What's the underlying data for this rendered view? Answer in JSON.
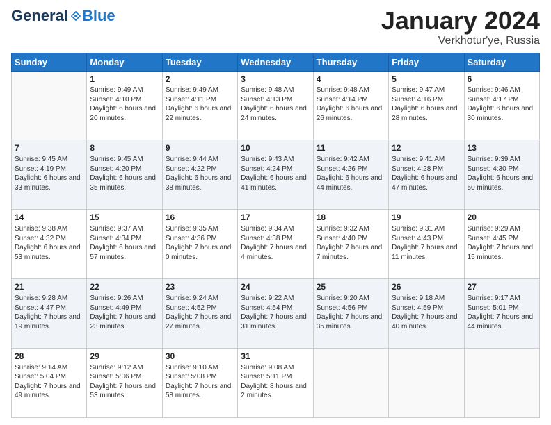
{
  "header": {
    "logo_general": "General",
    "logo_blue": "Blue",
    "month_title": "January 2024",
    "location": "Verkhotur'ye, Russia"
  },
  "days_of_week": [
    "Sunday",
    "Monday",
    "Tuesday",
    "Wednesday",
    "Thursday",
    "Friday",
    "Saturday"
  ],
  "weeks": [
    [
      {
        "day": "",
        "sunrise": "",
        "sunset": "",
        "daylight": ""
      },
      {
        "day": "1",
        "sunrise": "Sunrise: 9:49 AM",
        "sunset": "Sunset: 4:10 PM",
        "daylight": "Daylight: 6 hours and 20 minutes."
      },
      {
        "day": "2",
        "sunrise": "Sunrise: 9:49 AM",
        "sunset": "Sunset: 4:11 PM",
        "daylight": "Daylight: 6 hours and 22 minutes."
      },
      {
        "day": "3",
        "sunrise": "Sunrise: 9:48 AM",
        "sunset": "Sunset: 4:13 PM",
        "daylight": "Daylight: 6 hours and 24 minutes."
      },
      {
        "day": "4",
        "sunrise": "Sunrise: 9:48 AM",
        "sunset": "Sunset: 4:14 PM",
        "daylight": "Daylight: 6 hours and 26 minutes."
      },
      {
        "day": "5",
        "sunrise": "Sunrise: 9:47 AM",
        "sunset": "Sunset: 4:16 PM",
        "daylight": "Daylight: 6 hours and 28 minutes."
      },
      {
        "day": "6",
        "sunrise": "Sunrise: 9:46 AM",
        "sunset": "Sunset: 4:17 PM",
        "daylight": "Daylight: 6 hours and 30 minutes."
      }
    ],
    [
      {
        "day": "7",
        "sunrise": "Sunrise: 9:45 AM",
        "sunset": "Sunset: 4:19 PM",
        "daylight": "Daylight: 6 hours and 33 minutes."
      },
      {
        "day": "8",
        "sunrise": "Sunrise: 9:45 AM",
        "sunset": "Sunset: 4:20 PM",
        "daylight": "Daylight: 6 hours and 35 minutes."
      },
      {
        "day": "9",
        "sunrise": "Sunrise: 9:44 AM",
        "sunset": "Sunset: 4:22 PM",
        "daylight": "Daylight: 6 hours and 38 minutes."
      },
      {
        "day": "10",
        "sunrise": "Sunrise: 9:43 AM",
        "sunset": "Sunset: 4:24 PM",
        "daylight": "Daylight: 6 hours and 41 minutes."
      },
      {
        "day": "11",
        "sunrise": "Sunrise: 9:42 AM",
        "sunset": "Sunset: 4:26 PM",
        "daylight": "Daylight: 6 hours and 44 minutes."
      },
      {
        "day": "12",
        "sunrise": "Sunrise: 9:41 AM",
        "sunset": "Sunset: 4:28 PM",
        "daylight": "Daylight: 6 hours and 47 minutes."
      },
      {
        "day": "13",
        "sunrise": "Sunrise: 9:39 AM",
        "sunset": "Sunset: 4:30 PM",
        "daylight": "Daylight: 6 hours and 50 minutes."
      }
    ],
    [
      {
        "day": "14",
        "sunrise": "Sunrise: 9:38 AM",
        "sunset": "Sunset: 4:32 PM",
        "daylight": "Daylight: 6 hours and 53 minutes."
      },
      {
        "day": "15",
        "sunrise": "Sunrise: 9:37 AM",
        "sunset": "Sunset: 4:34 PM",
        "daylight": "Daylight: 6 hours and 57 minutes."
      },
      {
        "day": "16",
        "sunrise": "Sunrise: 9:35 AM",
        "sunset": "Sunset: 4:36 PM",
        "daylight": "Daylight: 7 hours and 0 minutes."
      },
      {
        "day": "17",
        "sunrise": "Sunrise: 9:34 AM",
        "sunset": "Sunset: 4:38 PM",
        "daylight": "Daylight: 7 hours and 4 minutes."
      },
      {
        "day": "18",
        "sunrise": "Sunrise: 9:32 AM",
        "sunset": "Sunset: 4:40 PM",
        "daylight": "Daylight: 7 hours and 7 minutes."
      },
      {
        "day": "19",
        "sunrise": "Sunrise: 9:31 AM",
        "sunset": "Sunset: 4:43 PM",
        "daylight": "Daylight: 7 hours and 11 minutes."
      },
      {
        "day": "20",
        "sunrise": "Sunrise: 9:29 AM",
        "sunset": "Sunset: 4:45 PM",
        "daylight": "Daylight: 7 hours and 15 minutes."
      }
    ],
    [
      {
        "day": "21",
        "sunrise": "Sunrise: 9:28 AM",
        "sunset": "Sunset: 4:47 PM",
        "daylight": "Daylight: 7 hours and 19 minutes."
      },
      {
        "day": "22",
        "sunrise": "Sunrise: 9:26 AM",
        "sunset": "Sunset: 4:49 PM",
        "daylight": "Daylight: 7 hours and 23 minutes."
      },
      {
        "day": "23",
        "sunrise": "Sunrise: 9:24 AM",
        "sunset": "Sunset: 4:52 PM",
        "daylight": "Daylight: 7 hours and 27 minutes."
      },
      {
        "day": "24",
        "sunrise": "Sunrise: 9:22 AM",
        "sunset": "Sunset: 4:54 PM",
        "daylight": "Daylight: 7 hours and 31 minutes."
      },
      {
        "day": "25",
        "sunrise": "Sunrise: 9:20 AM",
        "sunset": "Sunset: 4:56 PM",
        "daylight": "Daylight: 7 hours and 35 minutes."
      },
      {
        "day": "26",
        "sunrise": "Sunrise: 9:18 AM",
        "sunset": "Sunset: 4:59 PM",
        "daylight": "Daylight: 7 hours and 40 minutes."
      },
      {
        "day": "27",
        "sunrise": "Sunrise: 9:17 AM",
        "sunset": "Sunset: 5:01 PM",
        "daylight": "Daylight: 7 hours and 44 minutes."
      }
    ],
    [
      {
        "day": "28",
        "sunrise": "Sunrise: 9:14 AM",
        "sunset": "Sunset: 5:04 PM",
        "daylight": "Daylight: 7 hours and 49 minutes."
      },
      {
        "day": "29",
        "sunrise": "Sunrise: 9:12 AM",
        "sunset": "Sunset: 5:06 PM",
        "daylight": "Daylight: 7 hours and 53 minutes."
      },
      {
        "day": "30",
        "sunrise": "Sunrise: 9:10 AM",
        "sunset": "Sunset: 5:08 PM",
        "daylight": "Daylight: 7 hours and 58 minutes."
      },
      {
        "day": "31",
        "sunrise": "Sunrise: 9:08 AM",
        "sunset": "Sunset: 5:11 PM",
        "daylight": "Daylight: 8 hours and 2 minutes."
      },
      {
        "day": "",
        "sunrise": "",
        "sunset": "",
        "daylight": ""
      },
      {
        "day": "",
        "sunrise": "",
        "sunset": "",
        "daylight": ""
      },
      {
        "day": "",
        "sunrise": "",
        "sunset": "",
        "daylight": ""
      }
    ]
  ]
}
